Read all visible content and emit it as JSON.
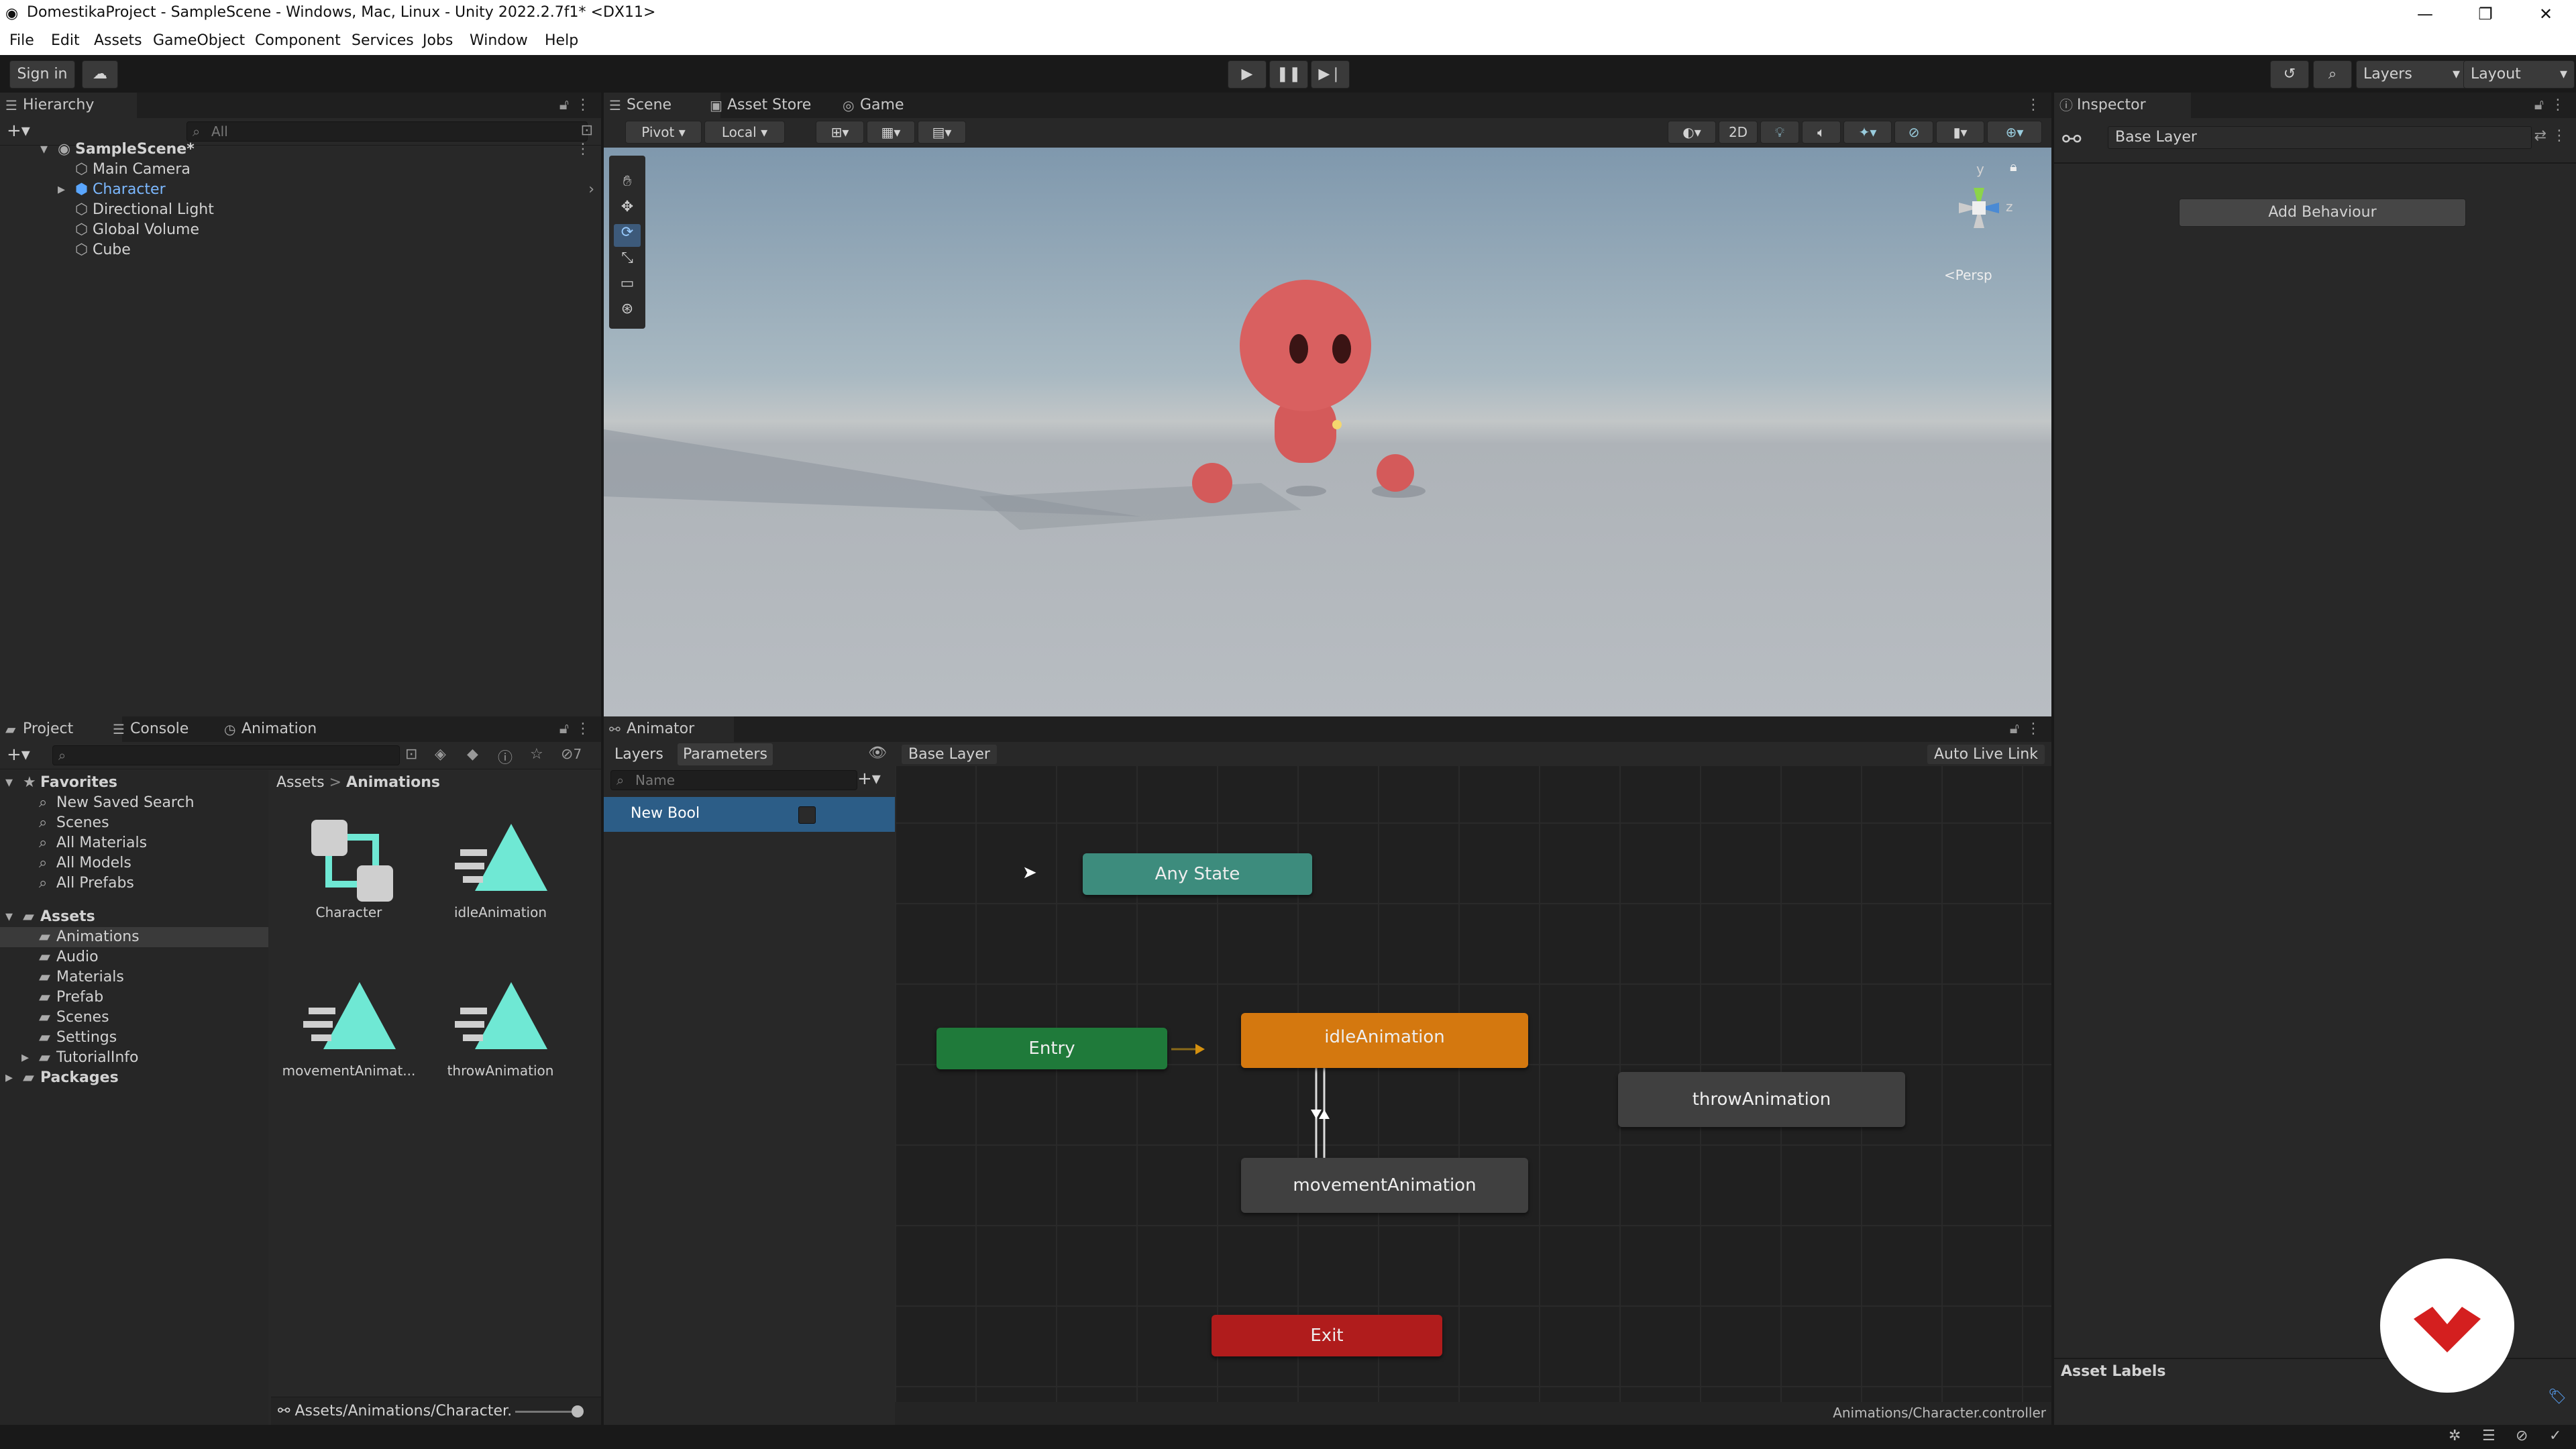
{
  "window": {
    "title": "DomestikaProject - SampleScene - Windows, Mac, Linux - Unity 2022.2.7f1* <DX11>",
    "controls": [
      "—",
      "❐",
      "✕"
    ]
  },
  "menu": [
    "File",
    "Edit",
    "Assets",
    "GameObject",
    "Component",
    "Services",
    "Jobs",
    "Window",
    "Help"
  ],
  "toolbar": {
    "sign_in": "Sign in",
    "layers": "Layers",
    "layout": "Layout"
  },
  "hierarchy": {
    "tab": "Hierarchy",
    "search_placeholder": "All",
    "scene": "SampleScene*",
    "items": [
      "Main Camera",
      "Character",
      "Directional Light",
      "Global Volume",
      "Cube"
    ]
  },
  "scene_view": {
    "tabs": [
      "Scene",
      "Asset Store",
      "Game"
    ],
    "pivot": "Pivot",
    "local": "Local",
    "btn_2d": "2D",
    "persp": "<Persp",
    "gizmo_y": "y",
    "gizmo_z": "z"
  },
  "inspector": {
    "tab": "Inspector",
    "layer_name": "Base Layer",
    "add_behaviour": "Add Behaviour",
    "asset_labels": "Asset Labels"
  },
  "project": {
    "tabs": [
      "Project",
      "Console",
      "Animation"
    ],
    "hidden_count": "7",
    "favorites_label": "Favorites",
    "favorites": [
      "New Saved Search",
      "Scenes",
      "All Materials",
      "All Models",
      "All Prefabs"
    ],
    "assets_label": "Assets",
    "folders": [
      "Animations",
      "Audio",
      "Materials",
      "Prefab",
      "Scenes",
      "Settings",
      "TutorialInfo"
    ],
    "packages_label": "Packages",
    "breadcrumb_root": "Assets",
    "breadcrumb_sep": ">",
    "breadcrumb_current": "Animations",
    "assets": [
      "Character",
      "idleAnimation",
      "movementAnimat...",
      "throwAnimation"
    ],
    "footer_path": "Assets/Animations/Character."
  },
  "animator": {
    "tab": "Animator",
    "layers_tab": "Layers",
    "parameters_tab": "Parameters",
    "breadcrumb": "Base Layer",
    "auto_live_link": "Auto Live Link",
    "param_search_placeholder": "Name",
    "parameters": [
      {
        "name": "New Bool",
        "type": "bool",
        "value": false
      }
    ],
    "nodes": {
      "any_state": "Any State",
      "entry": "Entry",
      "idle": "idleAnimation",
      "throw": "throwAnimation",
      "movement": "movementAnimation",
      "exit": "Exit"
    },
    "status_path": "Animations/Character.controller"
  },
  "colors": {
    "entry": "#1f7a3a",
    "any_state": "#3d8c7d",
    "default_state": "#d4780f",
    "exit": "#b01c1c",
    "state": "#404040",
    "selection": "#2c5d87"
  }
}
